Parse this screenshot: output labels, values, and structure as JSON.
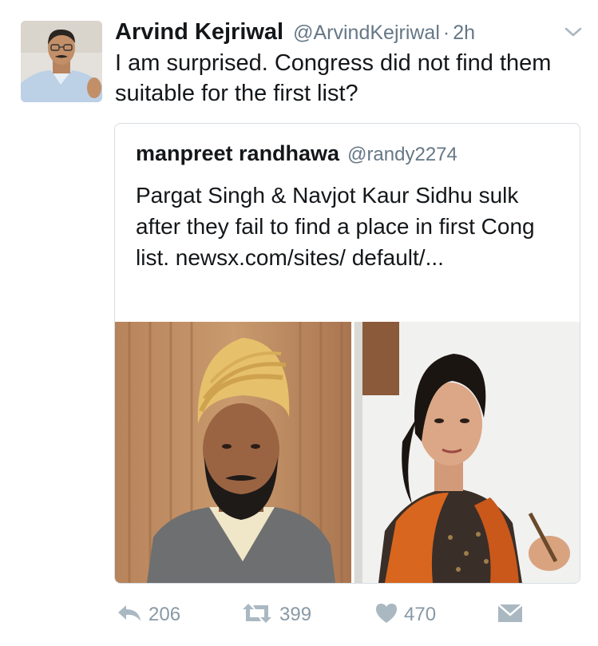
{
  "tweet": {
    "author_name": "Arvind Kejriwal",
    "author_handle": "@ArvindKejriwal",
    "separator": "·",
    "time": "2h",
    "text": "I am surprised. Congress did not find them suitable for the first list?"
  },
  "quoted": {
    "author_name": "manpreet randhawa",
    "author_handle": "@randy2274",
    "text": "Pargat Singh & Navjot Kaur Sidhu sulk after they fail to find a place in first Cong list. newsx.com/sites/ default/..."
  },
  "actions": {
    "reply_count": "206",
    "retweet_count": "399",
    "like_count": "470"
  },
  "icons": {
    "caret": "chevron-down-icon",
    "reply": "reply-icon",
    "retweet": "retweet-icon",
    "like": "heart-icon",
    "dm": "envelope-icon"
  },
  "colors": {
    "text": "#14171a",
    "secondary": "#657786",
    "action": "#8899a6",
    "border": "#d7dde2"
  }
}
